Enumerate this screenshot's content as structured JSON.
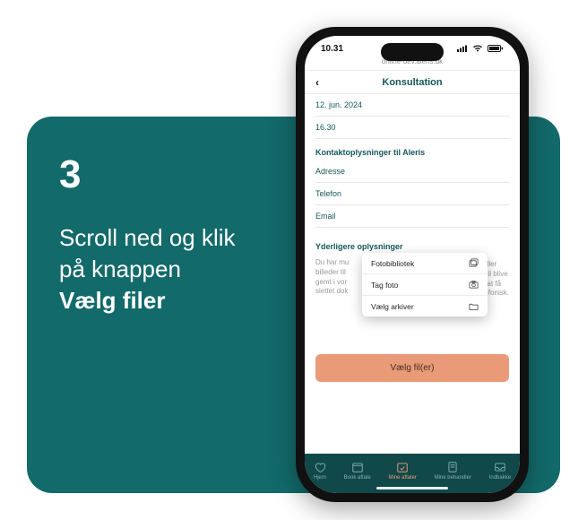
{
  "step": {
    "number": "3",
    "line1": "Scroll ned og klik",
    "line2": "på knappen",
    "bold": "Vælg filer"
  },
  "status": {
    "time": "10.31",
    "url": "online-dev.aleris.dk"
  },
  "header": {
    "title": "Konsultation"
  },
  "details": {
    "date": "12. jun. 2024",
    "time": "16.30"
  },
  "contact": {
    "heading": "Kontaktoplysninger til Aleris",
    "address_label": "Adresse",
    "phone_label": "Telefon",
    "email_label": "Email"
  },
  "extra": {
    "heading": "Yderligere oplysninger",
    "body_left_1": "Du har mu",
    "body_left_2": "billeder til",
    "body_left_3": "gemt i vor",
    "body_left_4": "slettet dok",
    "body_right_1": "r eller",
    "body_right_2": "s vil blive",
    "body_right_3": "er at få",
    "body_right_4": "elefonisk."
  },
  "popover": {
    "item1": "Fotobibliotek",
    "item2": "Tag foto",
    "item3": "Vælg arkiver"
  },
  "cta": {
    "label": "Vælg fil(er)"
  },
  "tabs": {
    "t1": "Hjem",
    "t2": "Book aftale",
    "t3": "Mine aftaler",
    "t4": "Mine behandler",
    "t5": "Indbakke"
  }
}
